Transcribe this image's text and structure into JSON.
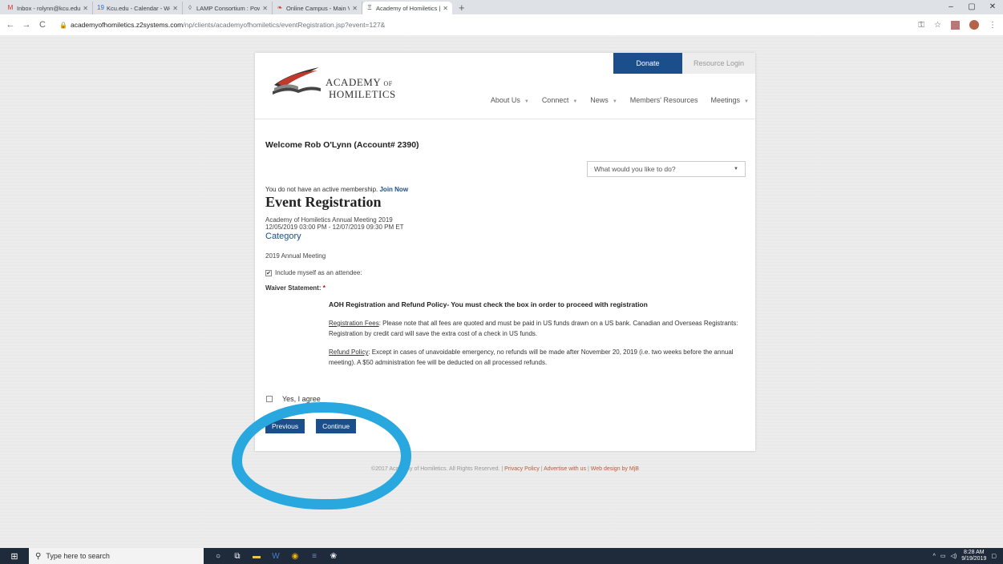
{
  "browser": {
    "tabs": [
      {
        "icon": "gmail-icon",
        "glyph": "M",
        "color": "#d93025",
        "label": "Inbox - rolynn@kcu.edu - Kcu.ed"
      },
      {
        "icon": "calendar-icon",
        "glyph": "19",
        "color": "#1a73e8",
        "label": "Kcu.edu - Calendar - Week of Se"
      },
      {
        "icon": "lamp-icon",
        "glyph": "◊",
        "color": "#666",
        "label": "LAMP Consortium : Powered by"
      },
      {
        "icon": "campus-icon",
        "glyph": "❧",
        "color": "#c0392b",
        "label": "Online Campus - Main View | Ho"
      },
      {
        "icon": "aoh-icon",
        "glyph": "Ξ",
        "color": "#333",
        "label": "Academy of Homiletics | Academ"
      }
    ],
    "new_tab": "+",
    "window_controls": {
      "minimize": "–",
      "maximize": "▢",
      "close": "✕"
    },
    "nav": {
      "back": "←",
      "forward": "→",
      "reload": "C"
    },
    "url_host": "academyofhomiletics.z2systems.com",
    "url_path": "/np/clients/academyofhomiletics/eventRegistration.jsp?event=127&"
  },
  "site": {
    "logo": {
      "line1": "ACADEMY",
      "line1_small": "OF",
      "line2": "HOMILETICS"
    },
    "donate": "Donate",
    "resource_login": "Resource Login",
    "nav": [
      "About Us",
      "Connect",
      "News",
      "Members' Resources",
      "Meetings"
    ],
    "nav_caret": "▼"
  },
  "content": {
    "welcome": "Welcome Rob O'Lynn (Account# 2390)",
    "todo_placeholder": "What would you like to do?",
    "member_note": "You do not have an active membership.",
    "join_now": "Join Now",
    "heading": "Event Registration",
    "event_name": "Academy of Homiletics Annual Meeting 2019",
    "event_dates": "12/05/2019 03:00 PM - 12/07/2019 09:30 PM ET",
    "category_label": "Category",
    "category_value": "2019 Annual Meeting",
    "include_label": "Include myself as an attendee:",
    "include_checked": "✔",
    "waiver_label": "Waiver Statement:",
    "waiver_req": "*",
    "policy_heading": "AOH Registration and Refund Policy- You must check the box in order to proceed with registration",
    "fees_label": "Registration Fees",
    "fees_text": ": Please note that all fees are quoted and must be paid in US funds drawn on a US bank. Canadian and Overseas Registrants: Registration by credit card will save the extra cost of a check in US funds.",
    "refund_label": "Refund Policy",
    "refund_text": ": Except in cases of unavoidable emergency, no refunds will be made after November 20, 2019 (i.e. two weeks before the annual meeting). A $50 administration fee will be deducted on all processed refunds.",
    "agree_label": "Yes, I agree",
    "previous": "Previous",
    "continue": "Continue"
  },
  "footer": {
    "copyright": "©2017 Academy of Homiletics. All Rights Reserved. |",
    "privacy": "Privacy Policy",
    "sep1": "|",
    "advertise": "Advertise with us",
    "sep2": "|",
    "design": "Web design by MjB"
  },
  "taskbar": {
    "search_placeholder": "Type here to search",
    "time": "8:28 AM",
    "date": "9/19/2019"
  }
}
